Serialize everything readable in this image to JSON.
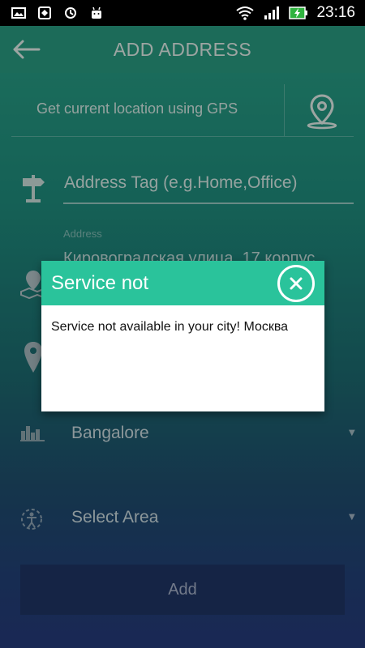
{
  "status_bar": {
    "time": "23:16",
    "icons": [
      "image-icon",
      "shield-icon",
      "sync-icon",
      "android-icon",
      "wifi-icon",
      "signal-icon",
      "battery-charging-icon"
    ]
  },
  "app_bar": {
    "back_icon": "arrow-left-icon",
    "title": "ADD ADDRESS"
  },
  "gps": {
    "label": "Get current location using GPS",
    "icon": "location-pin-icon"
  },
  "form": {
    "address_tag": {
      "placeholder": "Address Tag (e.g.Home,Office)",
      "icon": "signpost-icon"
    },
    "address": {
      "label": "Address",
      "value": "Кировоградская улица, 17 корпус",
      "icon": "map-icon"
    },
    "city": {
      "value": "Bangalore",
      "icon": "city-icon"
    },
    "area": {
      "value": "Select Area",
      "icon": "area-icon"
    },
    "add_button": "Add"
  },
  "dialog": {
    "title": "Service not",
    "message": "Service not available in your city! Москва",
    "close_icon": "close-icon"
  },
  "colors": {
    "accent": "#2ac39b",
    "app_bar": "#2a9e84",
    "add_button": "#1f3566"
  }
}
